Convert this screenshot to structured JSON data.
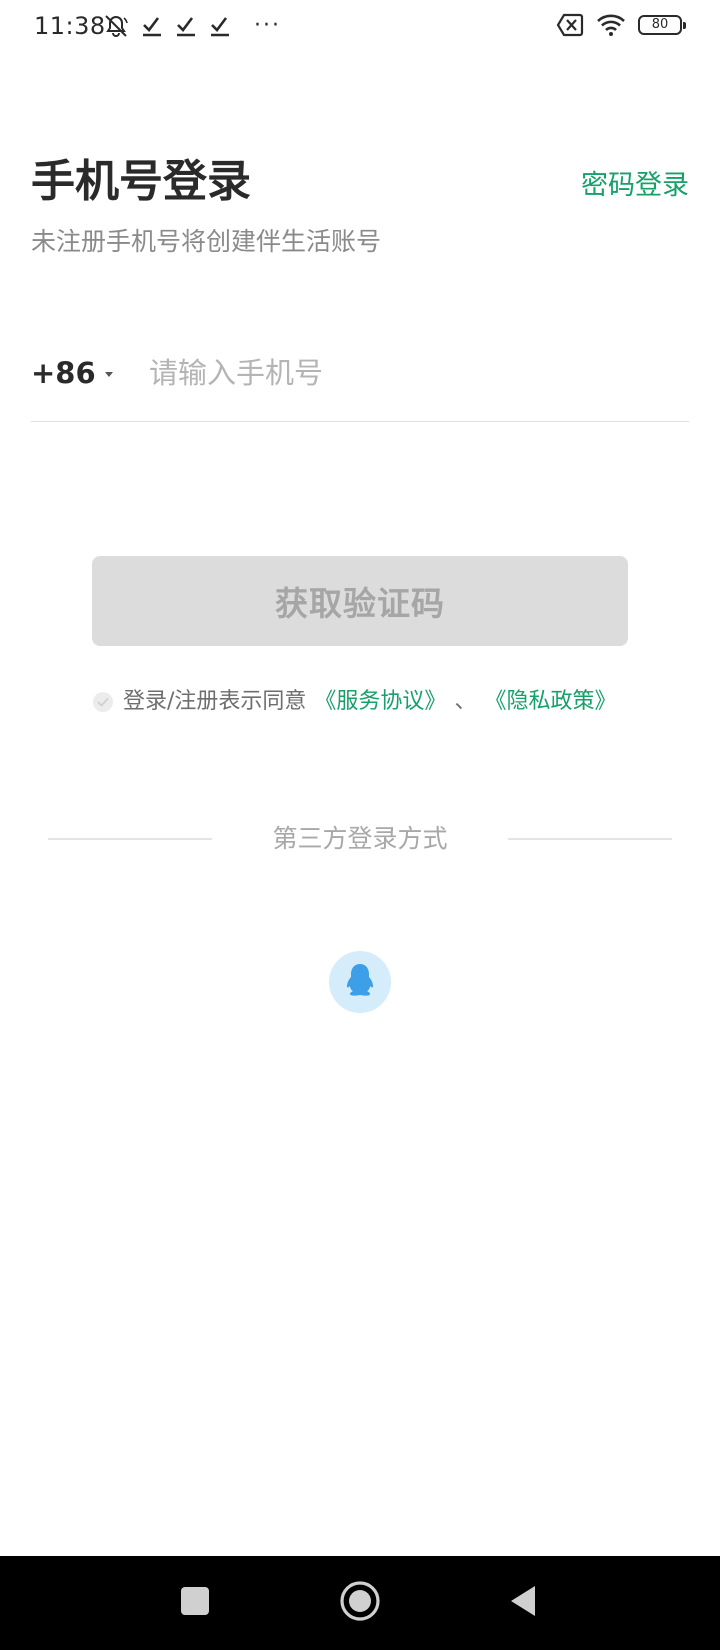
{
  "status_bar": {
    "time": "11:38",
    "more": "···",
    "battery": "80",
    "icons": [
      "mute-icon",
      "check-icon",
      "check-icon",
      "check-icon",
      "sim-off-icon",
      "wifi-icon",
      "battery-icon"
    ]
  },
  "header": {
    "title": "手机号登录",
    "subtitle": "未注册手机号将创建伴生活账号",
    "password_login": "密码登录"
  },
  "phone": {
    "country_code": "+86",
    "placeholder": "请输入手机号",
    "value": ""
  },
  "get_code_button": "获取验证码",
  "agreement": {
    "checked": false,
    "text": "登录/注册表示同意",
    "service_link": "《服务协议》",
    "separator": "、",
    "privacy_link": "《隐私政策》"
  },
  "third_party": {
    "label": "第三方登录方式",
    "providers": [
      "qq-icon"
    ]
  },
  "colors": {
    "accent": "#17a06a",
    "button_disabled_bg": "#dcdcdc",
    "button_disabled_text": "#a6a6a6",
    "qq_bg": "#d5ecfb",
    "qq_icon": "#3d9fe8"
  },
  "nav_bar": {
    "icons": [
      "recents-icon",
      "home-icon",
      "back-icon"
    ]
  }
}
